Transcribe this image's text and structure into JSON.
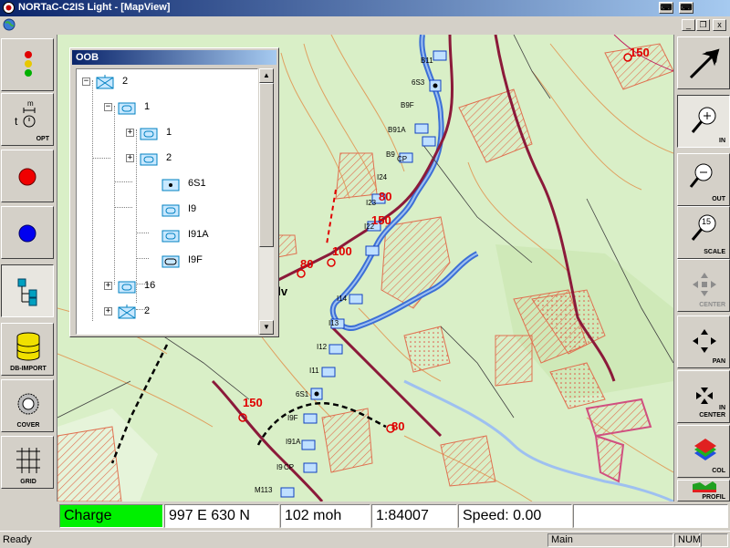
{
  "window": {
    "title": "NORTaC-C2IS Light - [MapView]",
    "title_buttons": [
      "⌨",
      "⌨"
    ],
    "mdi_buttons": [
      "_",
      "❐",
      "x"
    ]
  },
  "left_toolbar": {
    "items": [
      {
        "name": "traffic-light",
        "label": ""
      },
      {
        "name": "time-options",
        "label": "OPT",
        "top_label": "m",
        "prefix": "t"
      },
      {
        "name": "red-dot",
        "label": ""
      },
      {
        "name": "blue-dot",
        "label": ""
      },
      {
        "name": "oob-tree",
        "label": ""
      },
      {
        "name": "db-import",
        "label": "DB-IMPORT"
      },
      {
        "name": "cover",
        "label": "COVER"
      },
      {
        "name": "grid",
        "label": "GRID"
      }
    ]
  },
  "right_toolbar": {
    "items": [
      {
        "name": "pointer",
        "label": ""
      },
      {
        "name": "zoom-in",
        "label": "IN"
      },
      {
        "name": "zoom-out",
        "label": "OUT"
      },
      {
        "name": "scale",
        "label": "SCALE",
        "badge": "15"
      },
      {
        "name": "center",
        "label": "CENTER"
      },
      {
        "name": "pan",
        "label": "PAN"
      },
      {
        "name": "in-center",
        "label": "IN\nCENTER"
      },
      {
        "name": "col",
        "label": "COL"
      },
      {
        "name": "profil",
        "label": "PROFIL"
      }
    ]
  },
  "oob": {
    "title": "OOB",
    "nodes": [
      {
        "label": "2",
        "expander": "−"
      },
      {
        "label": "1",
        "expander": "−"
      },
      {
        "label": "1",
        "expander": "+"
      },
      {
        "label": "2",
        "expander": "+"
      },
      {
        "label": "6S1",
        "expander": ""
      },
      {
        "label": "I9",
        "expander": ""
      },
      {
        "label": "I91A",
        "expander": ""
      },
      {
        "label": "I9F",
        "expander": ""
      },
      {
        "label": "16",
        "expander": "+"
      },
      {
        "label": "2",
        "expander": "+"
      }
    ],
    "scroll_up": "▲",
    "scroll_down": "▼"
  },
  "map": {
    "speed_labels": [
      "150",
      "80",
      "150",
      "100",
      "80",
      "150",
      "80"
    ],
    "place_label": "elv",
    "unit_labels": [
      "B11",
      "6S3",
      "B9F",
      "B91A",
      "B9",
      "CP",
      "I24",
      "I23",
      "I22",
      "I14",
      "I13",
      "I12",
      "I11",
      "6S1",
      "I9F",
      "I91A",
      "I9",
      "CP",
      "M113"
    ]
  },
  "info": {
    "charge": "Charge",
    "coords": "997 E  630 N",
    "altitude": "102 moh",
    "scale": "1:84007",
    "speed": "Speed: 0.00"
  },
  "statusbar": {
    "ready": "Ready",
    "mode": "Main",
    "num": "NUM"
  },
  "colors": {
    "title_start": "#0a246a",
    "title_end": "#a6caf0",
    "charge_bg": "#00f000",
    "map_bg": "#d9efc7",
    "contour": "#e0a060",
    "river": "#3c6fd6",
    "road": "#8b1a3a",
    "speed_red": "#e00000"
  }
}
